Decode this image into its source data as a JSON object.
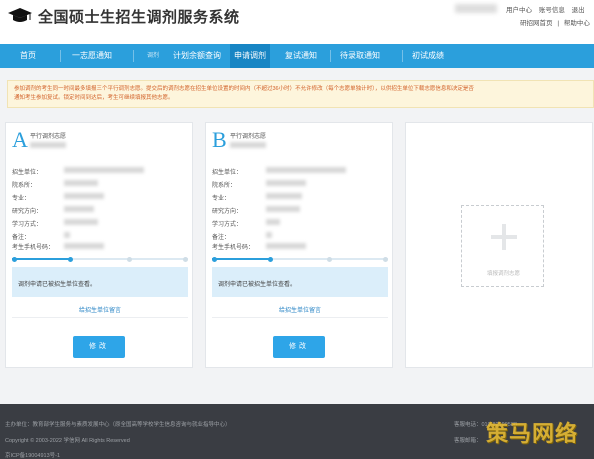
{
  "header": {
    "site_title": "全国硕士生招生调剂服务系统",
    "links_row1": [
      "用户中心",
      "账号信息",
      "退出"
    ],
    "links_row2": [
      "研招网首页",
      "|",
      "帮助中心"
    ]
  },
  "nav": {
    "items": [
      {
        "label": "首页"
      },
      {
        "label": "一志愿通知"
      },
      {
        "label": "调剂"
      },
      {
        "label": "计划余额查询"
      },
      {
        "label": "申请调剂",
        "active": true
      },
      {
        "label": "复试通知"
      },
      {
        "label": "待录取通知"
      },
      {
        "label": "初试成绩"
      }
    ]
  },
  "notice": {
    "line1": "参加调剂的考生同一时间最多填报三个平行调剂志愿。提交后的调剂志愿在招生单位设置的时间内（不超过36小时）不允许修改（每个志愿单独计时），以供招生单位下载志愿信息和决定是否",
    "line2": "通知考生参加复试。锁定时间到达后，考生可继续填报其他志愿。"
  },
  "cards": [
    {
      "letter": "A",
      "subtitle": "平行调剂志愿",
      "fields": [
        "招生单位：",
        "院系所：",
        "专业：",
        "研究方向：",
        "学习方式：",
        "备注：",
        "考生手机号码："
      ],
      "status": "调剂申请已被招生单位查看。",
      "link": "给招生单位留言",
      "button": "修改"
    },
    {
      "letter": "B",
      "subtitle": "平行调剂志愿",
      "fields": [
        "招生单位：",
        "院系所：",
        "专业：",
        "研究方向：",
        "学习方式：",
        "备注：",
        "考生手机号码："
      ],
      "status": "调剂申请已被招生单位查看。",
      "link": "给招生单位留言",
      "button": "修改"
    }
  ],
  "add_card": {
    "label": "填报调剂志愿"
  },
  "footer": {
    "line1": "主办单位：教育部学生服务与素质发展中心（原全国高等学校学生信息咨询与就业指导中心）",
    "line2": "Copyright © 2003-2022 学信网 All Rights Reserved",
    "line3": "京ICP备19004913号-1",
    "right1": "客服电话：010-82199588",
    "right2": "客服邮箱："
  },
  "watermark": "策马网络",
  "colors": {
    "accent": "#2b9fdc",
    "nav_active": "#1785c4",
    "notice_text": "#d2622a",
    "footer_bg": "#3a3d43"
  },
  "progress": {
    "fill_fraction": 0.33,
    "steps": 4,
    "active_steps": 2
  }
}
